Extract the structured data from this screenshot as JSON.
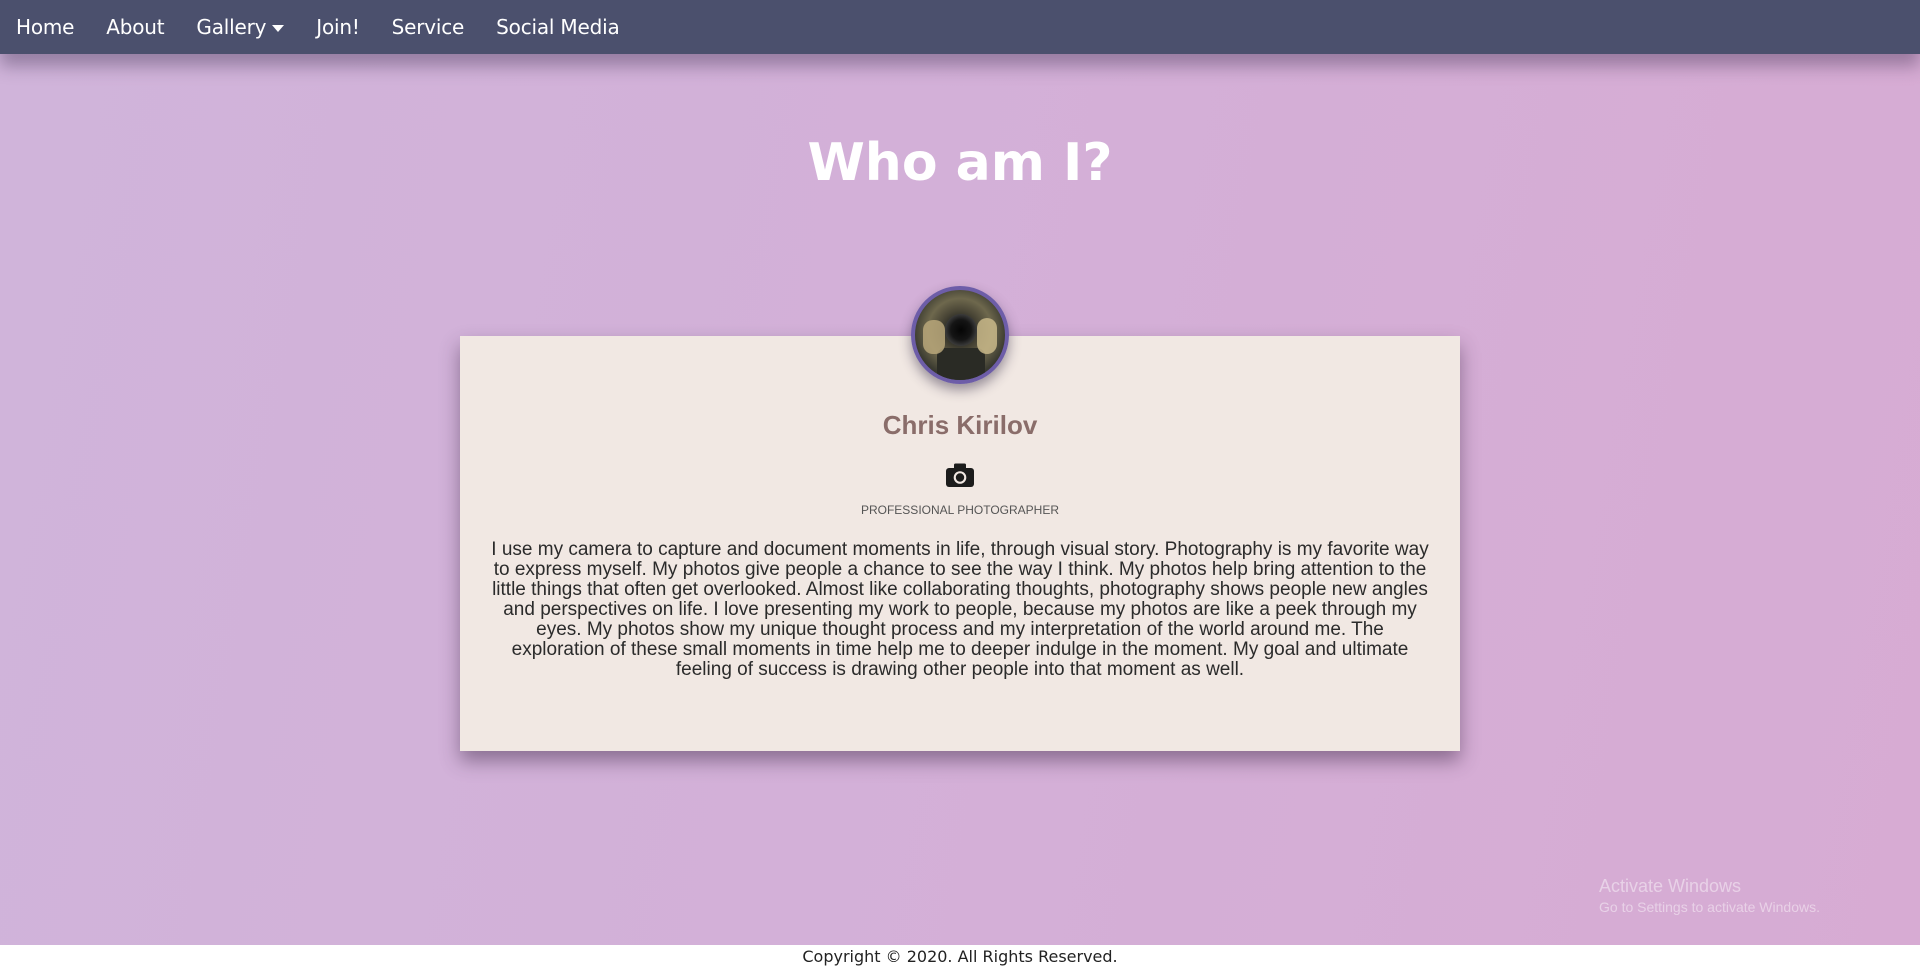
{
  "nav": {
    "items": [
      {
        "label": "Home"
      },
      {
        "label": "About"
      },
      {
        "label": "Gallery",
        "has_dropdown": true
      },
      {
        "label": "Join!"
      },
      {
        "label": "Service"
      },
      {
        "label": "Social Media"
      }
    ]
  },
  "page": {
    "title": "Who am I?"
  },
  "profile": {
    "name": "Chris Kirilov",
    "role_icon": "camera-icon",
    "role": "PROFESSIONAL PHOTOGRAPHER",
    "bio": "I use my camera to capture and document moments in life, through visual story. Photography is my favorite way to express myself. My photos give people a chance to see the way I think. My photos help bring attention to the little things that often get overlooked. Almost like collaborating thoughts, photography shows people new angles and perspectives on life. I love presenting my work to people, because my photos are like a peek through my eyes. My photos show my unique thought process and my interpretation of the world around me. The exploration of these small moments in time help me to deeper indulge in the moment. My goal and ultimate feeling of success is drawing other people into that moment as well."
  },
  "watermark": {
    "title": "Activate Windows",
    "subtitle": "Go to Settings to activate Windows."
  },
  "footer": {
    "copyright": "Copyright © 2020. All Rights Reserved."
  },
  "colors": {
    "navbar": "#4b506d",
    "background": "#d3b0d8",
    "card": "#f1e8e3",
    "name": "#8a6d6a",
    "avatar_border": "#6d5da8"
  }
}
